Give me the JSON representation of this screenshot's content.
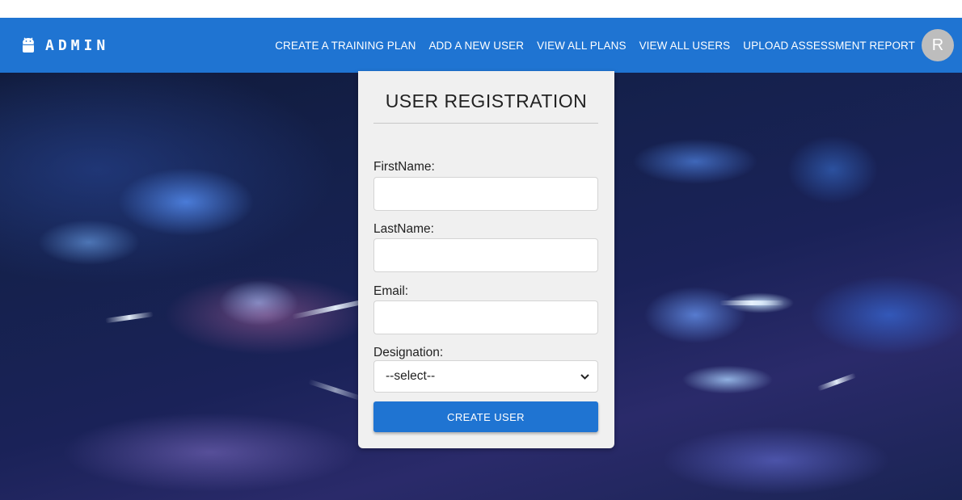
{
  "header": {
    "brand": "ADMIN",
    "brand_icon": "android-icon",
    "nav": [
      "CREATE A TRAINING PLAN",
      "ADD A NEW USER",
      "VIEW ALL PLANS",
      "VIEW ALL USERS",
      "UPLOAD ASSESSMENT REPORT"
    ],
    "avatar_initial": "R",
    "bar_color": "#1f74d2"
  },
  "form": {
    "title": "USER REGISTRATION",
    "fields": {
      "first_name_label": "FirstName:",
      "first_name_value": "",
      "last_name_label": "LastName:",
      "last_name_value": "",
      "email_label": "Email:",
      "email_value": "",
      "designation_label": "Designation:",
      "designation_selected": "--select--"
    },
    "submit_label": "CREATE USER"
  }
}
